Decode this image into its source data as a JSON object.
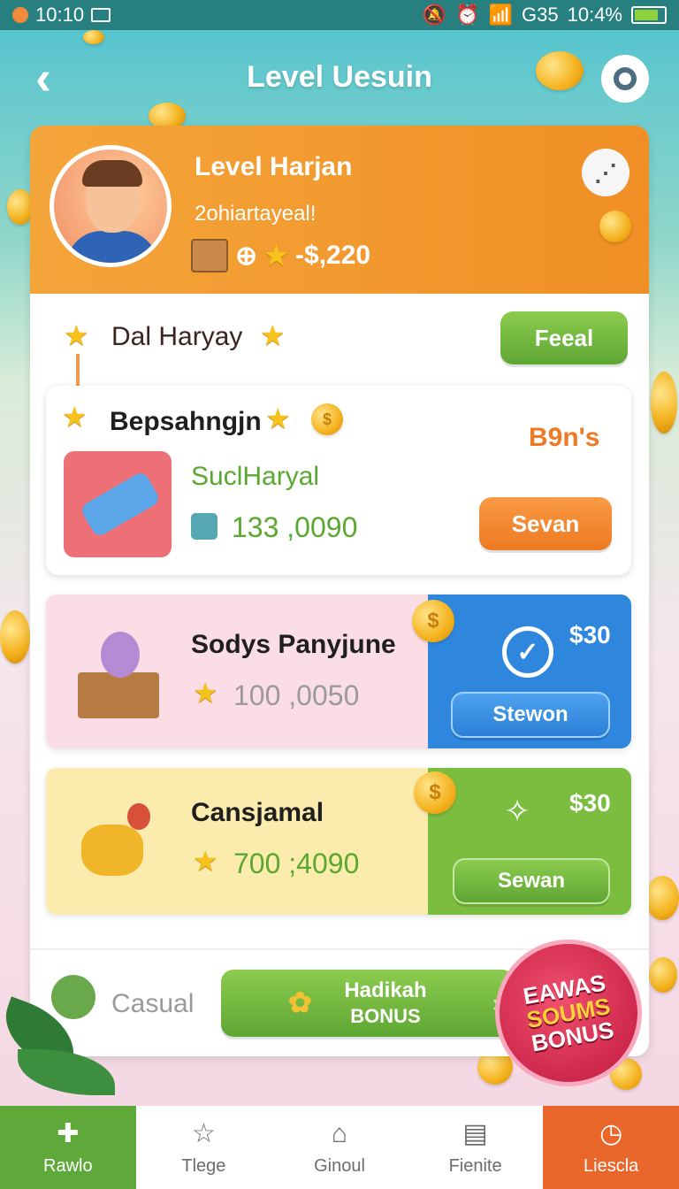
{
  "status_bar": {
    "time_left": "10:10",
    "signal": "G35",
    "time_right": "10:4%"
  },
  "header": {
    "title": "Level Uesuin"
  },
  "profile": {
    "name": "Level Harjan",
    "subtitle": "2ohiartayeal!",
    "stats": "-$,220"
  },
  "daily": {
    "label": "Dal Haryay",
    "button": "Feeal"
  },
  "offer1": {
    "title": "Bepsahngjn",
    "tag": "B9n's",
    "subtitle": "SuclHaryal",
    "value": "133 ,0090",
    "button": "Sevan"
  },
  "offer2": {
    "title": "Sodys Panyjune",
    "value": "100 ,0050",
    "price": "$30",
    "button": "Stewon"
  },
  "offer3": {
    "title": "Cansjamal",
    "value": "700 ;4090",
    "price": "$30",
    "button": "Sewan"
  },
  "casual": {
    "label": "Casual",
    "bonus_line1": "Hadikah",
    "bonus_line2": "BONUS"
  },
  "badge": {
    "line1": "EAWAS",
    "line2": "SOUMS",
    "line3": "BONUS"
  },
  "nav": [
    {
      "label": "Rawlo",
      "icon": "puzzle-icon"
    },
    {
      "label": "Tlege",
      "icon": "star-outline-icon"
    },
    {
      "label": "Ginoul",
      "icon": "home-icon"
    },
    {
      "label": "Fienite",
      "icon": "news-icon"
    },
    {
      "label": "Liescla",
      "icon": "stopwatch-icon"
    }
  ],
  "colors": {
    "primary_orange": "#f08f25",
    "green": "#5fa93b",
    "blue": "#2b7fd6",
    "nav_right": "#e9672b"
  }
}
